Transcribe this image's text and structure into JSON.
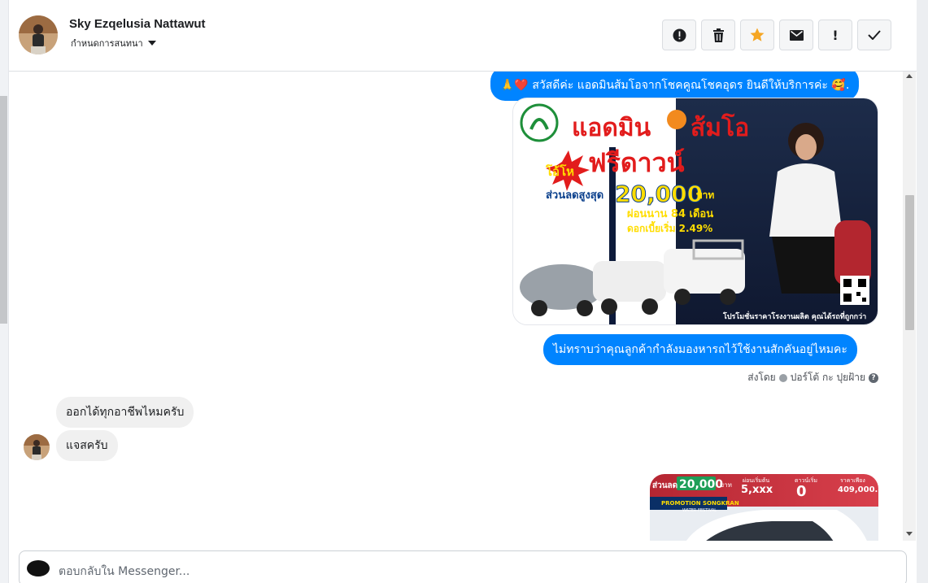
{
  "header": {
    "contact_name": "Sky Ezqelusia Nattawut",
    "assign_label": "กำหนดการสนทนา",
    "actions": [
      {
        "name": "mark-spam-button",
        "icon": "alert-circle-icon",
        "glyph": "!"
      },
      {
        "name": "delete-button",
        "icon": "trash-icon",
        "glyph": ""
      },
      {
        "name": "star-button",
        "icon": "star-icon",
        "glyph": "★"
      },
      {
        "name": "mark-unread-button",
        "icon": "envelope-icon",
        "glyph": ""
      },
      {
        "name": "mark-important-button",
        "icon": "exclamation-icon",
        "glyph": "!"
      },
      {
        "name": "mark-done-button",
        "icon": "check-icon",
        "glyph": "✓"
      }
    ]
  },
  "chat": {
    "greeting": "🙏❤️ สวัสดีค่ะ แอดมินส้มโอจากโชคคูณโชคอุดร ยินดีให้บริการค่ะ 🥰.",
    "ad_image": {
      "title_left": "แอดมิน",
      "title_right": "ส้มโอ",
      "badge": "โอ้โห",
      "headline": "ฟรีดาวน์",
      "discount_label": "ส่วนลดสูงสุด",
      "discount_value": "20,000",
      "discount_unit": "บาท",
      "installment": "ผ่อนนาน 84 เดือน",
      "interest": "ดอกเบี้ยเริ่ม 2.49%",
      "footer": "โปรโมชั่นราคาโรงงานผลิต คุณได้รถที่ถูกกว่า"
    },
    "question": "ไม่ทราบว่าคุณลูกค้ากำลังมองหารถไว้ใช้งานสักคันอยู่ไหมคะ",
    "sent_by_label": "ส่งโดย",
    "sent_by_name": "ปอร์โต้ กะ ปุยฝ้าย",
    "reply_1": "ออกได้ทุกอาชีพไหมครับ",
    "reply_2": "แจสครับ",
    "promo_image": {
      "discount_label": "ส่วนลด",
      "discount_value": "20,000",
      "discount_unit": "บาท",
      "monthly_label": "ผ่อนเริ่มต้น",
      "monthly_value": "5,xxx",
      "down_label": "ดาวน์เริ่ม",
      "down_value": "0",
      "price_label": "ราคาเพียง",
      "price_value": "409,000.-",
      "promo_name": "PROMOTION SONGKRAN",
      "promo_sub": "WATER FESTIVAL"
    }
  },
  "reply_box": {
    "placeholder": "ตอบกลับใน Messenger..."
  }
}
